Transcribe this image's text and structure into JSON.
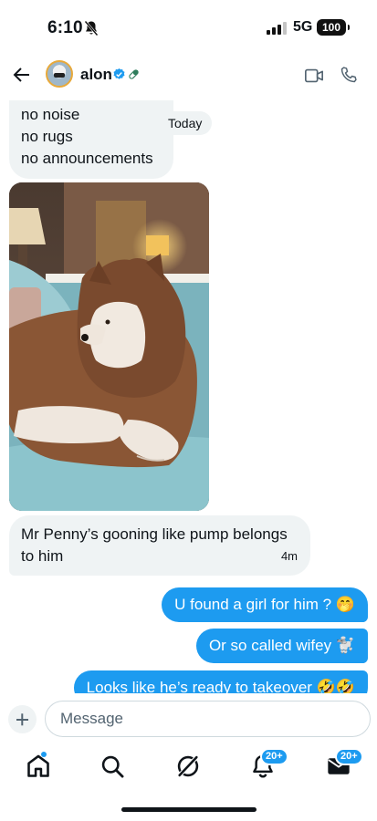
{
  "status_bar": {
    "time": "6:10",
    "network": "5G",
    "battery": "100"
  },
  "header": {
    "username": "alon"
  },
  "chat": {
    "messages_in": {
      "first_lines": [
        "no noise",
        "no rugs",
        "no announcements"
      ],
      "second_text": "Mr Penny’s gooning like pump belongs to him",
      "second_time": "4m"
    },
    "date_label": "Today",
    "messages_out": [
      "U found a girl for him ? 🤭",
      "Or so called wifey 🐩",
      "Looks like he’s ready to takeover 🤣🤣"
    ]
  },
  "composer": {
    "placeholder": "Message"
  },
  "nav": {
    "notifications_badge": "20+",
    "messages_badge": "20+"
  },
  "colors": {
    "accent": "#1d9bf0",
    "incoming_bubble": "#eff3f4",
    "text": "#0f1419"
  },
  "icons": [
    "back-arrow-icon",
    "verified-icon",
    "pill-icon",
    "video-icon",
    "phone-icon",
    "plus-icon",
    "home-icon",
    "search-icon",
    "grok-icon",
    "bell-icon",
    "mail-icon"
  ]
}
